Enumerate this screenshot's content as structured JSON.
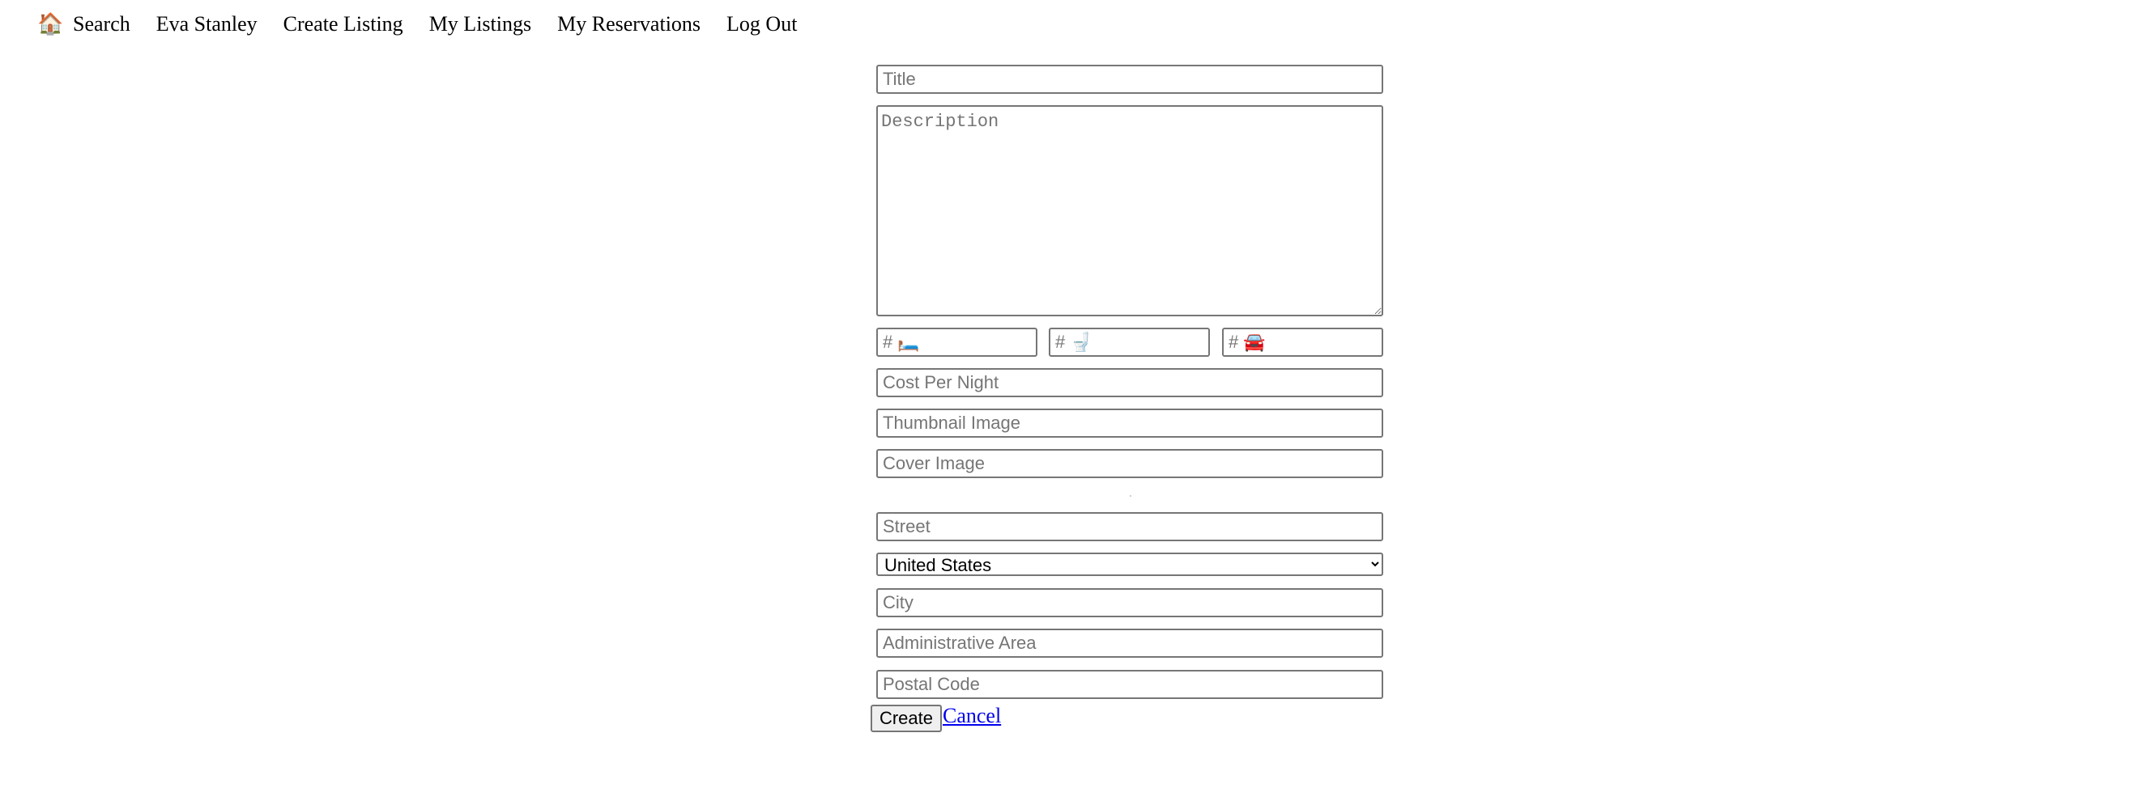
{
  "nav": {
    "home_icon": "🏠",
    "home_icon_name": "house-icon",
    "items": [
      {
        "label": "Search"
      },
      {
        "label": "Eva Stanley"
      },
      {
        "label": "Create Listing"
      },
      {
        "label": "My Listings"
      },
      {
        "label": "My Reservations"
      },
      {
        "label": "Log Out"
      }
    ]
  },
  "form": {
    "title": {
      "placeholder": "Title",
      "value": ""
    },
    "description": {
      "placeholder": "Description",
      "value": ""
    },
    "bedrooms": {
      "placeholder": "# 🛏️",
      "value": ""
    },
    "bathrooms": {
      "placeholder": "# 🚽",
      "value": ""
    },
    "parking": {
      "placeholder": "# 🚘",
      "value": ""
    },
    "cost_per_night": {
      "placeholder": "Cost Per Night",
      "value": ""
    },
    "thumbnail_image": {
      "placeholder": "Thumbnail Image",
      "value": ""
    },
    "cover_image": {
      "placeholder": "Cover Image",
      "value": ""
    },
    "street": {
      "placeholder": "Street",
      "value": ""
    },
    "country": {
      "selected": "United States",
      "options": [
        "United States"
      ]
    },
    "city": {
      "placeholder": "City",
      "value": ""
    },
    "administrative_area": {
      "placeholder": "Administrative Area",
      "value": ""
    },
    "postal_code": {
      "placeholder": "Postal Code",
      "value": ""
    },
    "create_label": "Create",
    "cancel_label": "Cancel"
  }
}
